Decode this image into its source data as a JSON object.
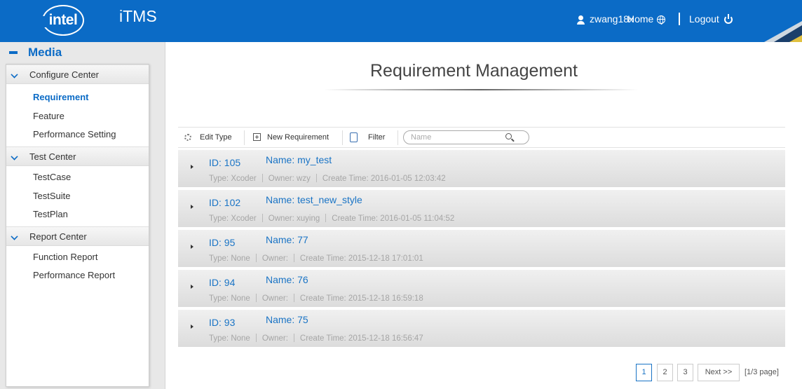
{
  "header": {
    "logo_text": "intel",
    "app_title": "iTMS",
    "username": "zwang18x",
    "home_label": "Home",
    "logout_label": "Logout",
    "accent_color": "#0b6bc6"
  },
  "sidebar": {
    "section_title": "Media",
    "groups": [
      {
        "label": "Configure Center",
        "items": [
          "Requirement",
          "Feature",
          "Performance Setting"
        ]
      },
      {
        "label": "Test Center",
        "items": [
          "TestCase",
          "TestSuite",
          "TestPlan"
        ]
      },
      {
        "label": "Report Center",
        "items": [
          "Function Report",
          "Performance Report"
        ]
      }
    ],
    "active_item": "Requirement"
  },
  "main": {
    "title": "Requirement Management",
    "toolbar": {
      "edit_type": "Edit Type",
      "new_requirement": "New Requirement",
      "filter": "Filter",
      "search_placeholder": "Name"
    },
    "requirements": [
      {
        "id": "ID: 105",
        "name": "Name: my_test",
        "type": "Type: Xcoder",
        "owner": "Owner: wzy",
        "create_time": "Create Time: 2016-01-05 12:03:42"
      },
      {
        "id": "ID: 102",
        "name": "Name: test_new_style",
        "type": "Type: Xcoder",
        "owner": "Owner: xuying",
        "create_time": "Create Time: 2016-01-05 11:04:52"
      },
      {
        "id": "ID: 95",
        "name": "Name: 77",
        "type": "Type: None",
        "owner": "Owner:",
        "create_time": "Create Time: 2015-12-18 17:01:01"
      },
      {
        "id": "ID: 94",
        "name": "Name: 76",
        "type": "Type: None",
        "owner": "Owner:",
        "create_time": "Create Time: 2015-12-18 16:59:18"
      },
      {
        "id": "ID: 93",
        "name": "Name: 75",
        "type": "Type: None",
        "owner": "Owner:",
        "create_time": "Create Time: 2015-12-18 16:56:47"
      }
    ],
    "pagination": {
      "pages": [
        "1",
        "2",
        "3"
      ],
      "current_page": "1",
      "next_label": "Next >>",
      "info": "[1/3 page]"
    }
  }
}
